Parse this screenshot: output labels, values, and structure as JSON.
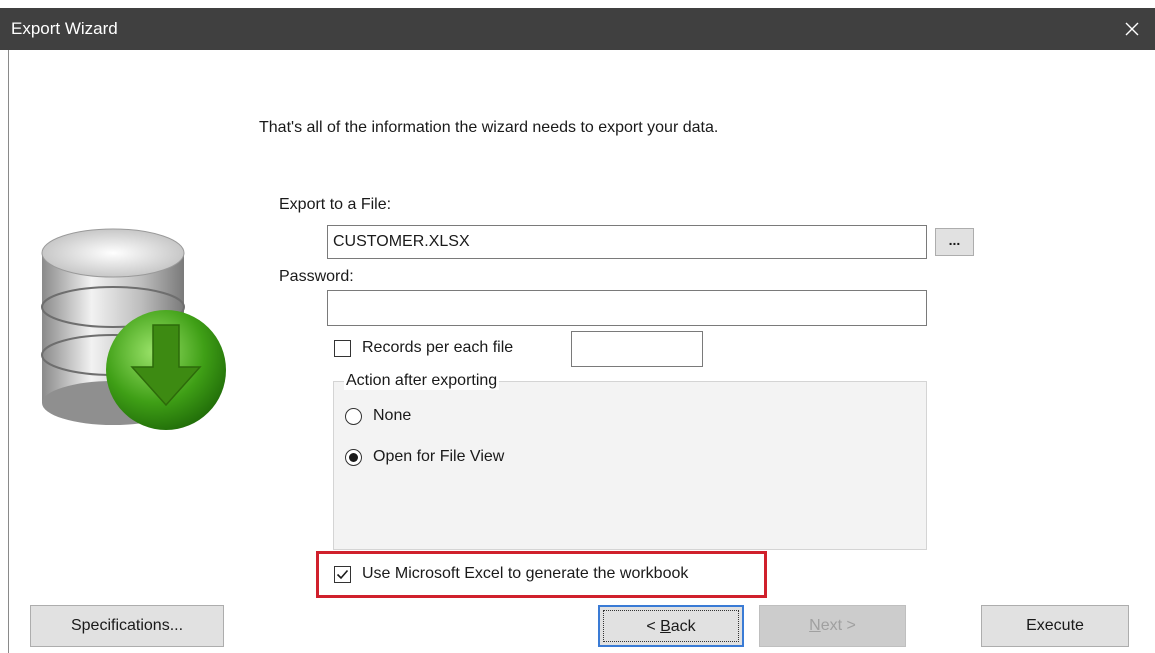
{
  "window": {
    "title": "Export Wizard",
    "close_icon": "close-icon"
  },
  "wizard": {
    "intro_text": "That's all of the information the wizard needs to export your data.",
    "illustration_icon": "database-export-icon",
    "export_file": {
      "label": "Export to a File:",
      "value": "CUSTOMER.XLSX",
      "browse_label": "..."
    },
    "password": {
      "label": "Password:",
      "value": ""
    },
    "records_per_file": {
      "label": "Records per each file",
      "checked": false,
      "value": ""
    },
    "action_group": {
      "legend": "Action after exporting",
      "options": [
        {
          "label": "None",
          "selected": false
        },
        {
          "label": "Open for File View",
          "selected": true
        }
      ]
    },
    "use_excel": {
      "label": "Use Microsoft Excel to generate the workbook",
      "checked": true,
      "highlight_color": "#d0202c"
    }
  },
  "footer": {
    "specifications_label": "Specifications...",
    "back_label_prefix": "< ",
    "back_label_underlined": "B",
    "back_label_rest": "ack",
    "next_label_underlined": "N",
    "next_label_rest": "ext >",
    "execute_label": "Execute"
  },
  "colors": {
    "titlebar": "#404040",
    "accent": "#3a7bd5",
    "arrow_green": "#4caf1a"
  }
}
